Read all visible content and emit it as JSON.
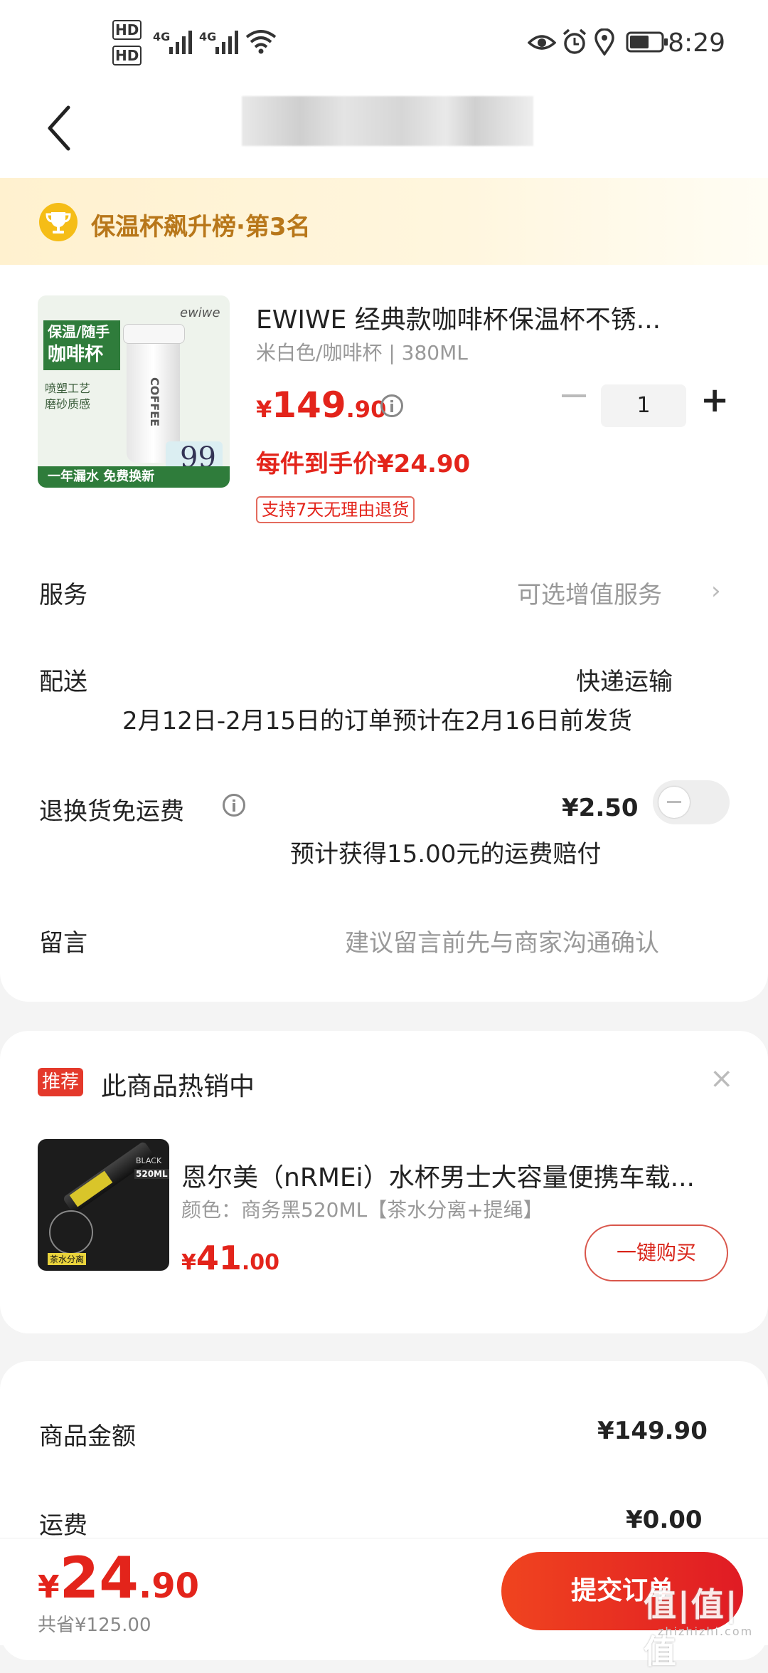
{
  "status_bar": {
    "time": "8:29",
    "sim1": "HD",
    "sim2": "HD",
    "net1": "4G",
    "net2": "4G",
    "icons": [
      "eye-comfort-icon",
      "alarm-icon",
      "location-icon",
      "battery-icon"
    ]
  },
  "rank_banner": {
    "text": "保温杯飙升榜·第3名",
    "icon": "trophy-icon"
  },
  "product": {
    "name": "EWIWE 经典款咖啡杯保温杯不锈...",
    "spec": "米白色/咖啡杯 | 380ML",
    "price_symbol": "¥",
    "price_int": "149",
    "price_dec": ".90",
    "quantity": "1",
    "deal_price": "每件到手价¥24.90",
    "return_badge": "支持7天无理由退货",
    "image_text": {
      "brand": "ewiwe",
      "line1": "保温/随手",
      "line2": "咖啡杯",
      "line3": "喷塑工艺",
      "line4": "磨砂质感",
      "cup_text": "COFFEE",
      "price_tag": "99",
      "bottom": "一年漏水 免费换新"
    }
  },
  "service": {
    "label": "服务",
    "value": "可选增值服务"
  },
  "delivery": {
    "label": "配送",
    "method": "快递运输",
    "note": "2月12日-2月15日的订单预计在2月16日前发货"
  },
  "return_shipping": {
    "label": "退换货免运费",
    "price": "¥2.50",
    "note": "预计获得15.00元的运费赔付",
    "enabled": false
  },
  "message": {
    "label": "留言",
    "placeholder": "建议留言前先与商家沟通确认"
  },
  "recommend": {
    "badge": "推荐",
    "title": "此商品热销中",
    "name": "恩尔美（nRMEi）水杯男士大容量便携车载...",
    "spec": "颜色：商务黑520ML【茶水分离+提绳】",
    "price_symbol": "¥",
    "price_int": "41",
    "price_dec": ".00",
    "buy_label": "一键购买",
    "image_text": {
      "tag": "520ML",
      "color": "BLACK",
      "bottom": "茶水分离"
    }
  },
  "summary": {
    "goods_label": "商品金额",
    "goods_value": "¥149.90",
    "shipping_label": "运费",
    "shipping_value": "¥0.00"
  },
  "bottom_bar": {
    "total_symbol": "¥",
    "total_int": "24",
    "total_dec": ".90",
    "saved": "共省¥125.00",
    "submit_label": "提交订单",
    "watermark": "值|值|值",
    "watermark_url": "zhizhizhi.com"
  },
  "colors": {
    "accent_red": "#e3241b",
    "rank_gold": "#b8771a",
    "banner_bg": "#fff1cf"
  }
}
